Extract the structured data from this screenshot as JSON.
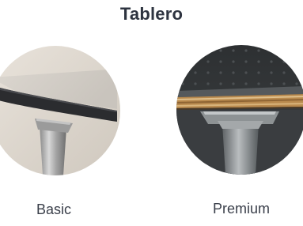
{
  "header": {
    "title": "Tablero"
  },
  "options": [
    {
      "label": "Basic",
      "image": "basic-tabletop-edge-photo"
    },
    {
      "label": "Premium",
      "image": "premium-tabletop-edge-photo"
    }
  ]
}
